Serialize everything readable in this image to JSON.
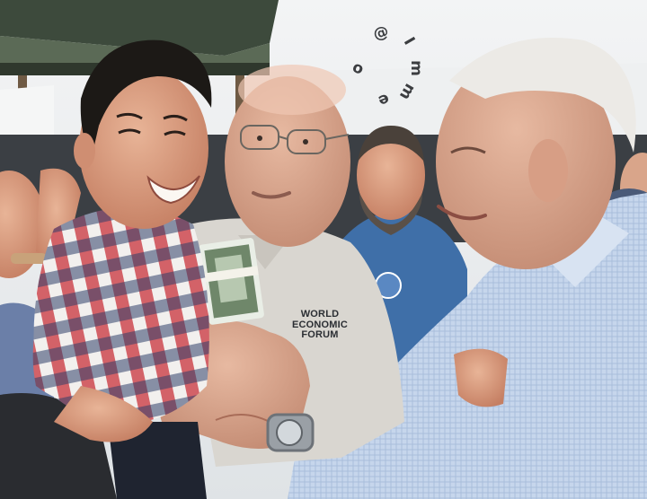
{
  "photo": {
    "people": [
      "smiling-young-man-held-like-child",
      "bald-man-in-glasses-holding-cash",
      "white-haired-man-in-blue-shirt",
      "bearded-man-in-background"
    ],
    "props": [
      "banknote-stack",
      "wristwatch"
    ]
  },
  "shirt_logo": {
    "line1": "WORLD",
    "line2": "ECONOMIC",
    "line3": "FORUM"
  },
  "watermark": {
    "text": "@ I m m e o",
    "chars": [
      "@",
      "I",
      "m",
      "m",
      "e",
      "o"
    ]
  },
  "colors": {
    "sky": "#e9ecee",
    "gingham_red": "#c8323a",
    "gingham_navy": "#2f3f6a",
    "polo_grey": "#d9d6d0",
    "blue_shirt": "#b9cde6",
    "skin": "#d99a7c"
  }
}
